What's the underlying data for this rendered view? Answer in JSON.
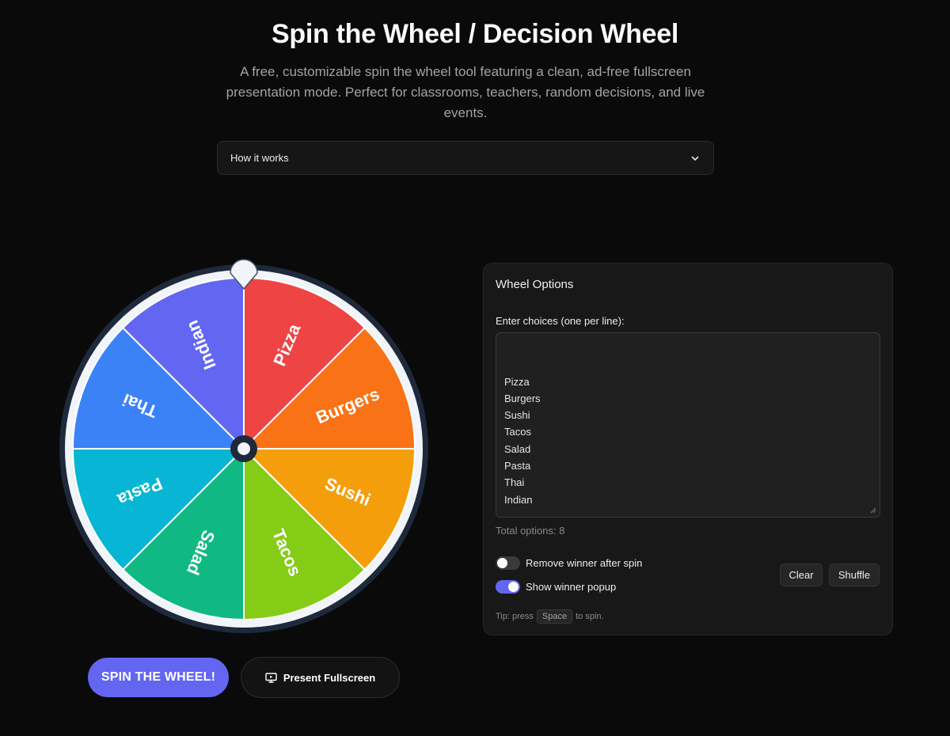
{
  "header": {
    "title": "Spin the Wheel / Decision Wheel",
    "subtitle": "A free, customizable spin the wheel tool featuring a clean, ad-free fullscreen presentation mode. Perfect for classrooms, teachers, random decisions, and live events."
  },
  "accordion": {
    "label": "How it works",
    "icon": "chevron-down-icon"
  },
  "wheel": {
    "segments": [
      {
        "label": "Pizza",
        "color": "#ef4444"
      },
      {
        "label": "Burgers",
        "color": "#f97316"
      },
      {
        "label": "Sushi",
        "color": "#f59e0b"
      },
      {
        "label": "Tacos",
        "color": "#84cc16"
      },
      {
        "label": "Salad",
        "color": "#10b981"
      },
      {
        "label": "Pasta",
        "color": "#06b6d4"
      },
      {
        "label": "Thai",
        "color": "#3b82f6"
      },
      {
        "label": "Indian",
        "color": "#6366f1"
      }
    ],
    "rim_color": "#f1f5f9",
    "hub_color": "#1e293b"
  },
  "actions": {
    "spin_label": "SPIN THE WHEEL!",
    "present_label": "Present Fullscreen",
    "present_icon": "monitor-icon"
  },
  "options": {
    "title": "Wheel Options",
    "choices_label": "Enter choices (one per line):",
    "choices": [
      "Pizza",
      "Burgers",
      "Sushi",
      "Tacos",
      "Salad",
      "Pasta",
      "Thai",
      "Indian"
    ],
    "total_label": "Total options: 8",
    "remove_winner": {
      "label": "Remove winner after spin",
      "on": false
    },
    "show_popup": {
      "label": "Show winner popup",
      "on": true
    },
    "clear_label": "Clear",
    "shuffle_label": "Shuffle",
    "tip_prefix": "Tip: press",
    "tip_key": "Space",
    "tip_suffix": "to spin."
  },
  "colors": {
    "accent": "#6366f1",
    "background": "#0a0a0b"
  }
}
